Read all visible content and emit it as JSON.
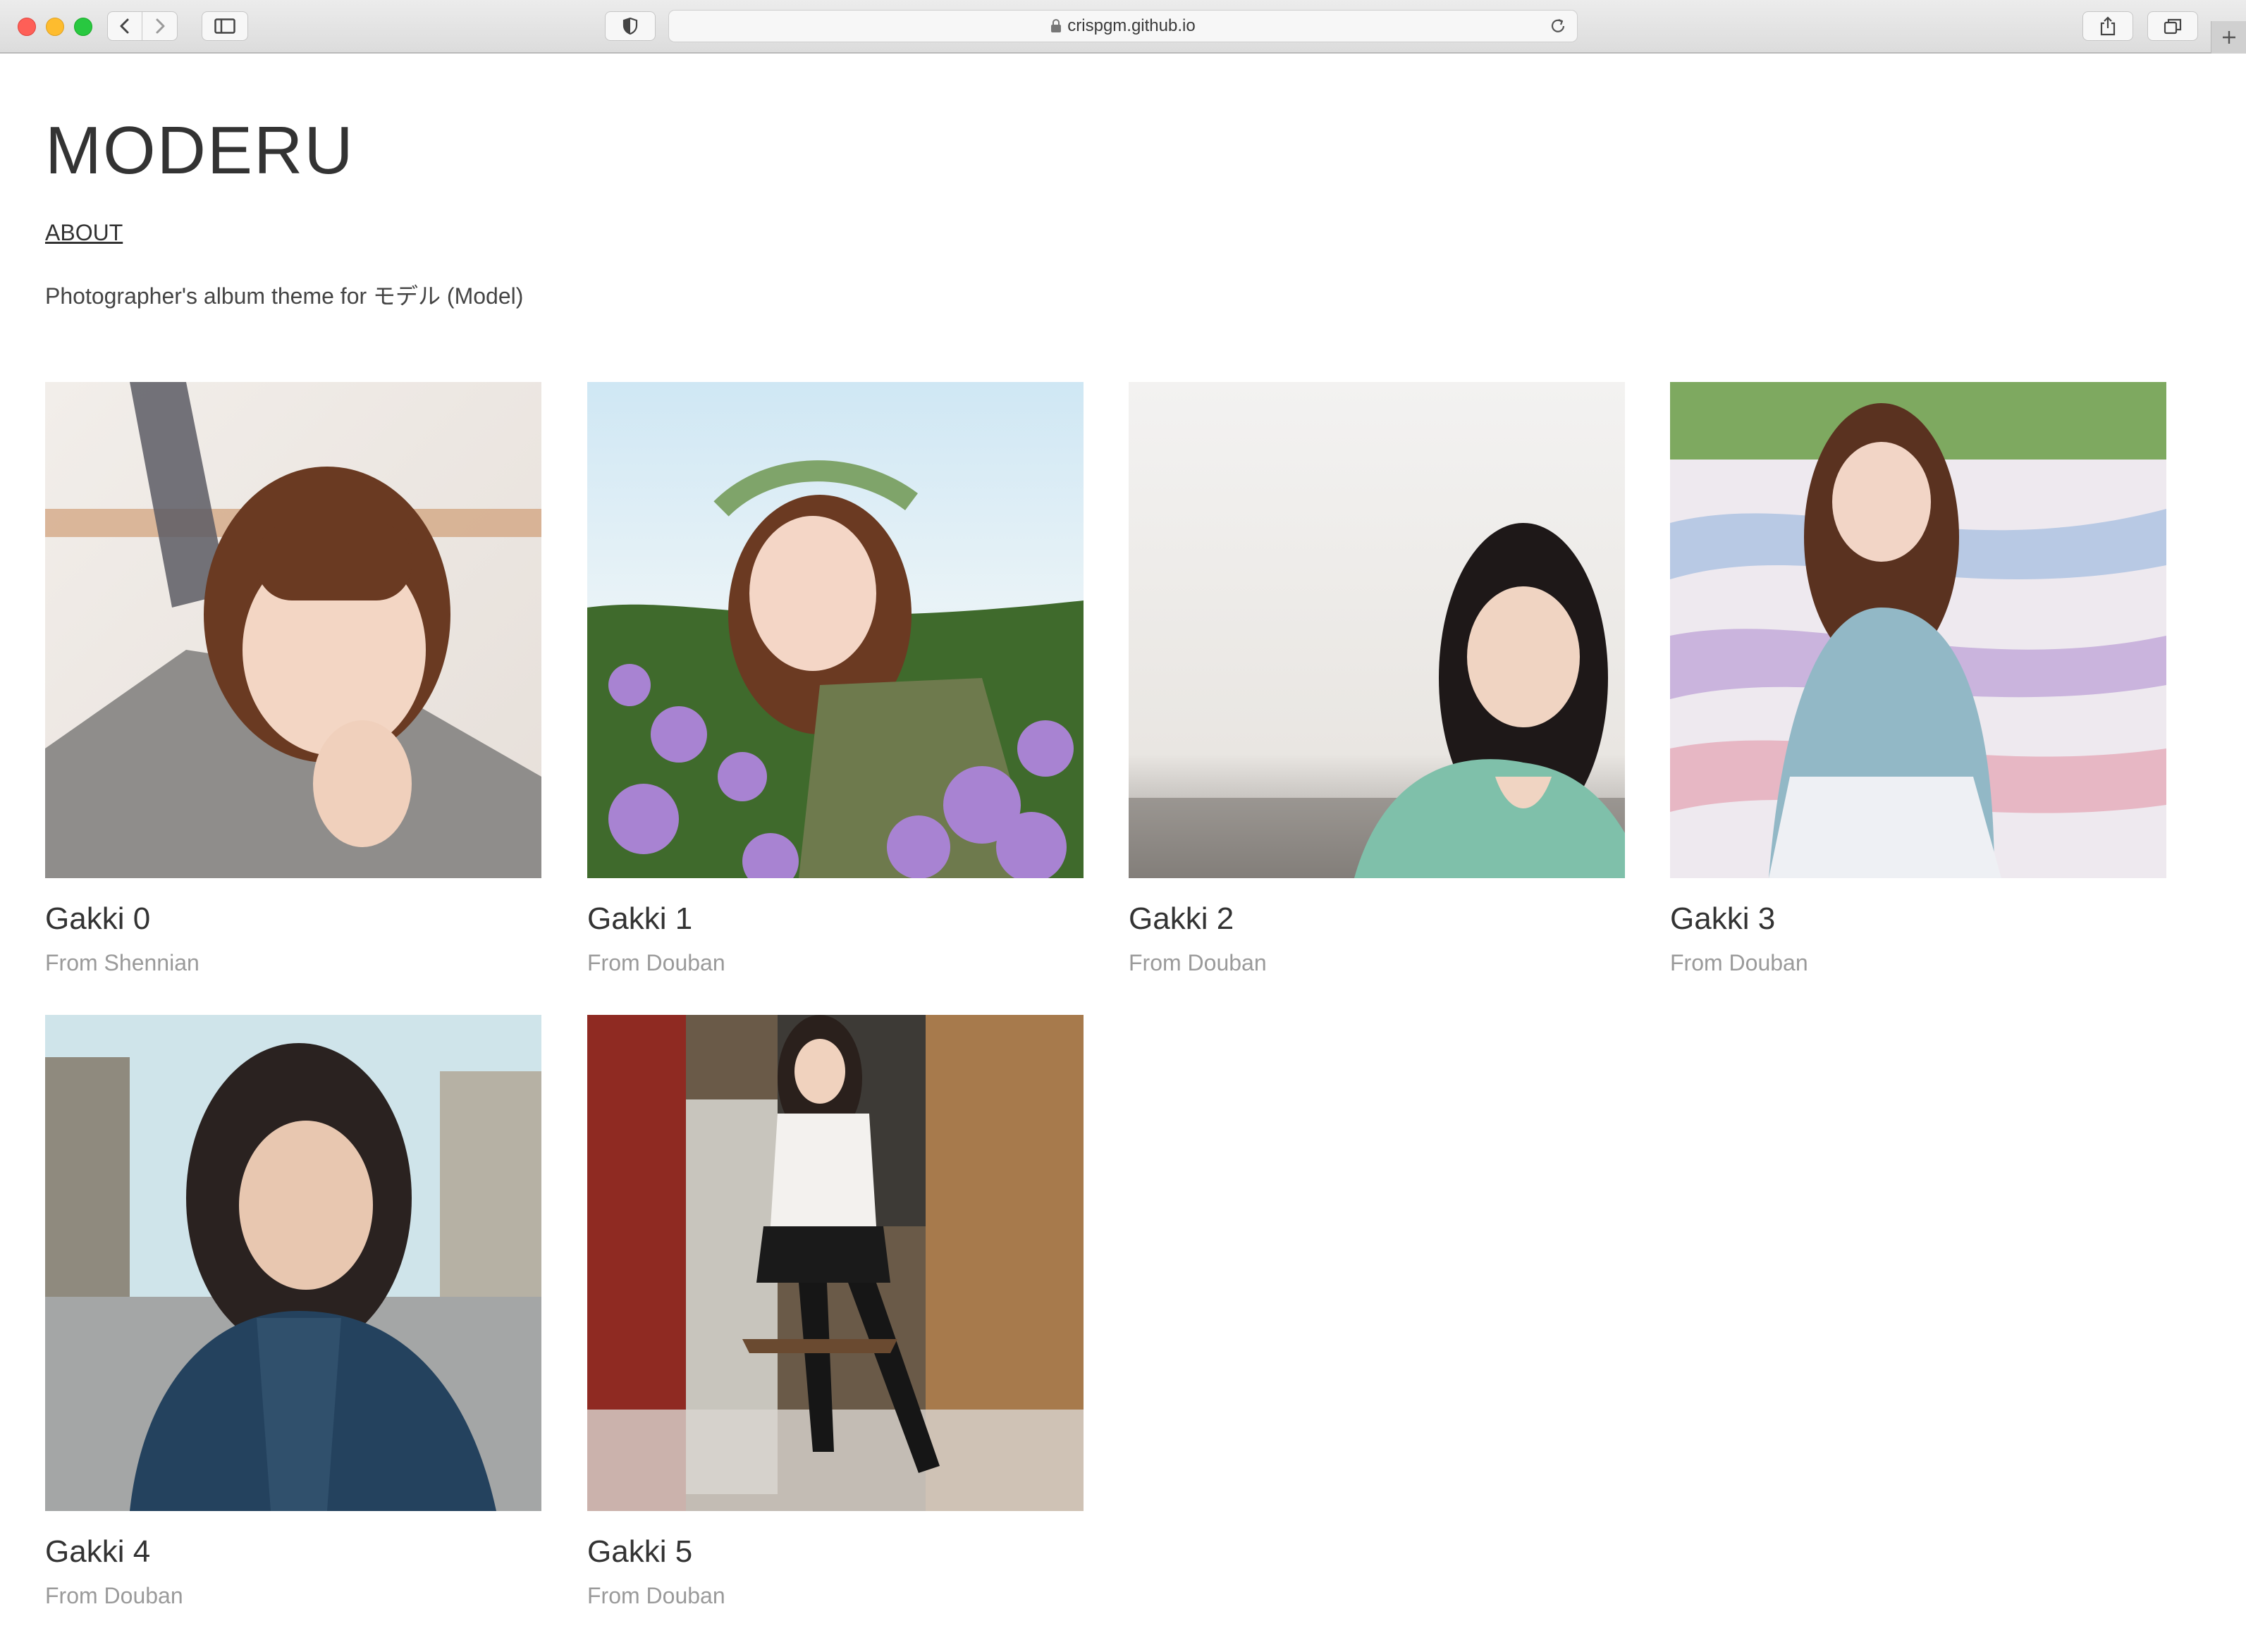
{
  "browser": {
    "url": "crispgm.github.io"
  },
  "site": {
    "title": "MODERU",
    "about_label": "ABOUT",
    "tagline": "Photographer's album theme for モデル (Model)"
  },
  "albums": [
    {
      "title": "Gakki 0",
      "source": "From Shennian"
    },
    {
      "title": "Gakki 1",
      "source": "From Douban"
    },
    {
      "title": "Gakki 2",
      "source": "From Douban"
    },
    {
      "title": "Gakki 3",
      "source": "From Douban"
    },
    {
      "title": "Gakki 4",
      "source": "From Douban"
    },
    {
      "title": "Gakki 5",
      "source": "From Douban"
    }
  ]
}
